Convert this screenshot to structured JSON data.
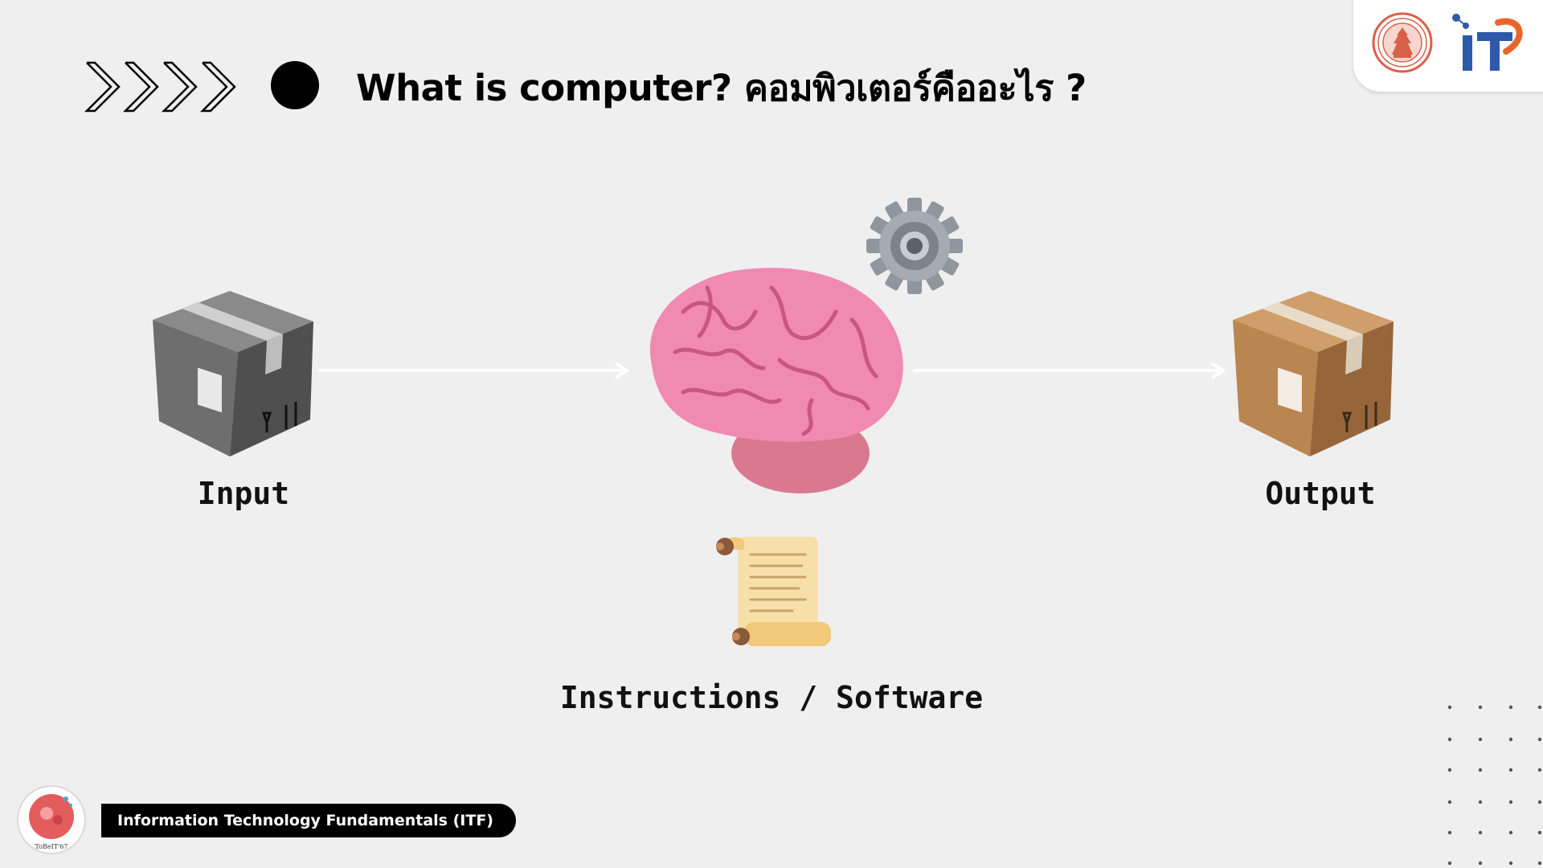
{
  "header": {
    "title": "What is computer? คอมพิวเตอร์คืออะไร ?"
  },
  "diagram": {
    "input_label": "Input",
    "output_label": "Output",
    "process_label": "Instructions / Software",
    "icons": {
      "input": "gray-box-icon",
      "process": "brain-icon",
      "gear": "gear-icon",
      "instructions": "scroll-icon",
      "output": "brown-box-icon"
    }
  },
  "footer": {
    "course": "Information Technology Fundamentals (ITF)",
    "badge_text": "ToBeIT'67"
  },
  "colors": {
    "background": "#efefef",
    "accent_blue": "#2d5aa8",
    "accent_orange": "#e8662a",
    "seal_red": "#d9604a",
    "brain_pink": "#f08ab0",
    "box_brown": "#b98550",
    "box_gray": "#6e6e6e"
  }
}
